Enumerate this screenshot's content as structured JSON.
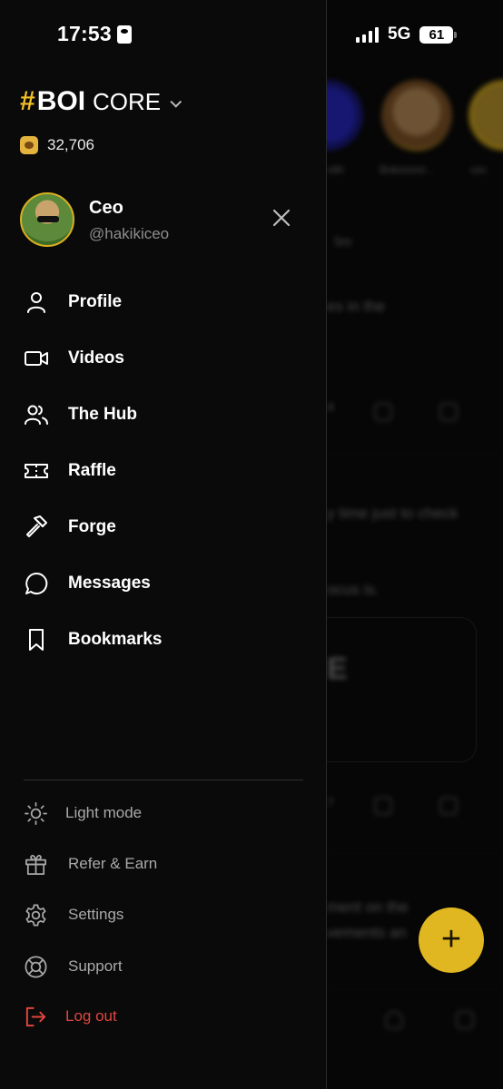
{
  "status_bar": {
    "time": "17:53",
    "network": "5G",
    "battery": "61"
  },
  "brand": {
    "hash": "#",
    "name": "BOI",
    "product": "CORE"
  },
  "points": {
    "value": "32,706"
  },
  "profile": {
    "name": "Ceo",
    "handle": "@hakikiceo"
  },
  "menu": [
    {
      "label": "Profile",
      "icon": "user-icon"
    },
    {
      "label": "Videos",
      "icon": "video-icon"
    },
    {
      "label": "The Hub",
      "icon": "users-icon"
    },
    {
      "label": "Raffle",
      "icon": "ticket-icon"
    },
    {
      "label": "Forge",
      "icon": "hammer-icon"
    },
    {
      "label": "Messages",
      "icon": "message-icon"
    },
    {
      "label": "Bookmarks",
      "icon": "bookmark-icon"
    }
  ],
  "secondary_menu": [
    {
      "label": "Light mode",
      "icon": "sun-icon"
    },
    {
      "label": "Refer & Earn",
      "icon": "gift-icon"
    },
    {
      "label": "Settings",
      "icon": "gear-icon"
    },
    {
      "label": "Support",
      "icon": "lifebuoy-icon"
    },
    {
      "label": "Log out",
      "icon": "logout-icon"
    }
  ],
  "background_feed": {
    "story_captions": [
      "vith",
      "Bokononi...",
      "cec"
    ],
    "post_time": "5m",
    "text_lines": [
      "es in the",
      "y time just to check",
      "ocus is.",
      "E",
      "ment on the",
      "vements an"
    ],
    "counts": [
      "4",
      "7"
    ]
  },
  "colors": {
    "accent": "#f2c028",
    "danger": "#e0463e",
    "drawer_bg": "#0a0a0a"
  }
}
